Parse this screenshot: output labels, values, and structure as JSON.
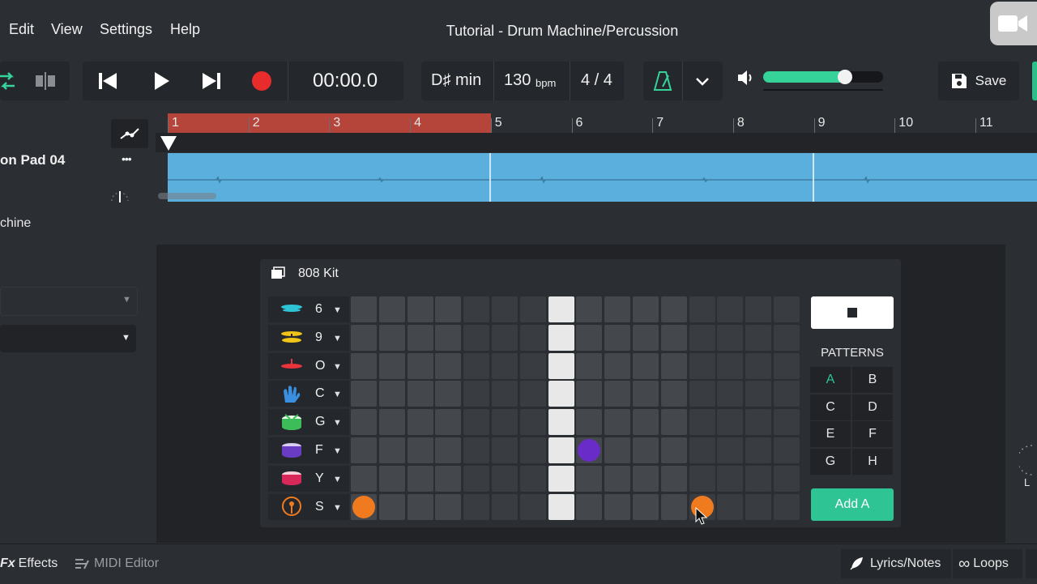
{
  "menu": {
    "items": [
      "Edit",
      "View",
      "Settings",
      "Help"
    ]
  },
  "window": {
    "title": "Tutorial - Drum Machine/Percussion"
  },
  "transport": {
    "time": "00:00.0",
    "key": "D♯ min",
    "tempo_value": "130",
    "tempo_unit": "bpm",
    "time_signature": "4 / 4",
    "volume_level": 0.68,
    "save_label": "Save"
  },
  "timeline": {
    "bars": [
      "1",
      "2",
      "3",
      "4",
      "5",
      "6",
      "7",
      "8",
      "9",
      "10",
      "11"
    ],
    "loop_bars": "1-4"
  },
  "track": {
    "name": "on Pad 04",
    "more": "•••"
  },
  "panel": {
    "label": "chine"
  },
  "drum_machine": {
    "kit_name": "808 Kit",
    "instruments": [
      {
        "key": "6",
        "icon": "hihat-icon",
        "color": "#2ec4d6"
      },
      {
        "key": "9",
        "icon": "crash-cymbal-icon",
        "color": "#f0c419"
      },
      {
        "key": "O",
        "icon": "open-hihat-icon",
        "color": "#e8343a"
      },
      {
        "key": "C",
        "icon": "clap-icon",
        "color": "#3a8fe0"
      },
      {
        "key": "G",
        "icon": "snare-drum-icon",
        "color": "#3dbd5a"
      },
      {
        "key": "F",
        "icon": "tom-drum-icon",
        "color": "#6a3cc4"
      },
      {
        "key": "Y",
        "icon": "kick-drum-icon",
        "color": "#d8285a"
      },
      {
        "key": "S",
        "icon": "bass-drum-icon",
        "color": "#f07a1e"
      }
    ],
    "steps": 16,
    "playhead_step": 8,
    "active_notes": [
      {
        "row": 5,
        "step": 9,
        "color": "#6a2cc8"
      },
      {
        "row": 7,
        "step": 1,
        "color": "#f07a1e"
      },
      {
        "row": 7,
        "step": 13,
        "color": "#f07a1e"
      }
    ],
    "patterns_title": "PATTERNS",
    "patterns": [
      "A",
      "B",
      "C",
      "D",
      "E",
      "F",
      "G",
      "H"
    ],
    "selected_pattern": "A",
    "add_label": "Add A"
  },
  "bottom": {
    "effects_prefix": "Fx",
    "effects": "Effects",
    "midi_editor": "MIDI Editor",
    "lyrics": "Lyrics/Notes",
    "loops": "Loops"
  },
  "side_letter": "L",
  "colors": {
    "accent": "#2fc493",
    "loop_region": "#b5443a",
    "clip": "#5aafdc"
  }
}
